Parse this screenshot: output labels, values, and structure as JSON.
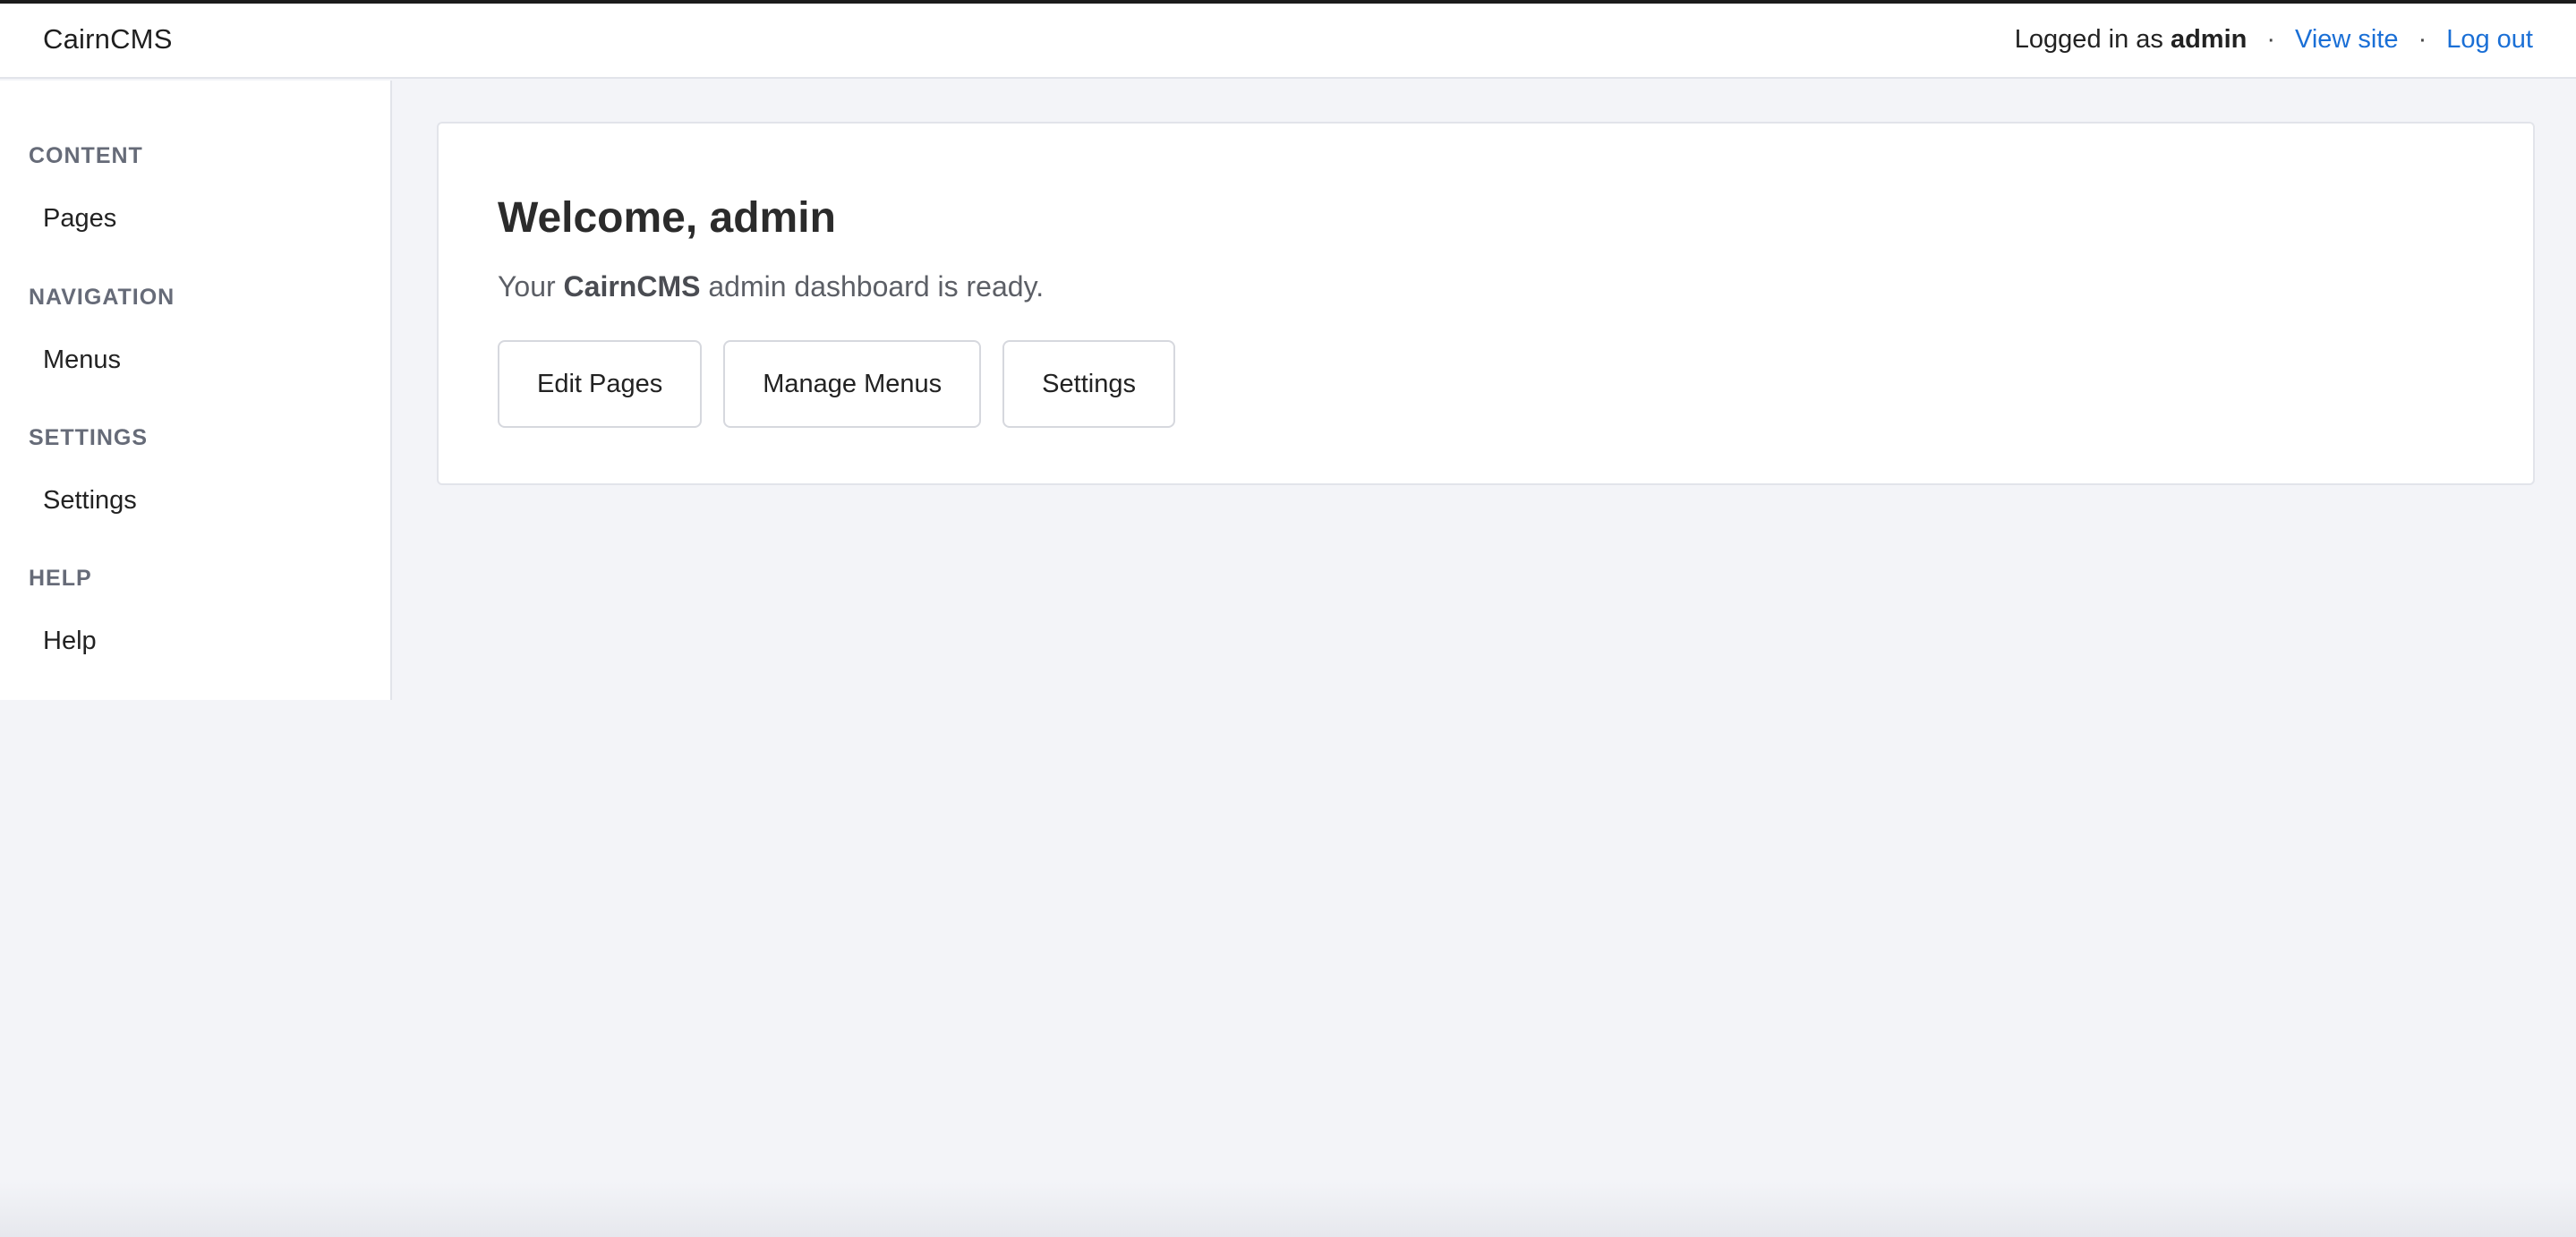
{
  "header": {
    "brand": "CairnCMS",
    "logged_in_prefix": "Logged in as",
    "username": "admin",
    "separator": "·",
    "view_site": "View site",
    "log_out": "Log out"
  },
  "sidebar": {
    "sections": [
      {
        "heading": "CONTENT",
        "item": "Pages"
      },
      {
        "heading": "NAVIGATION",
        "item": "Menus"
      },
      {
        "heading": "SETTINGS",
        "item": "Settings"
      },
      {
        "heading": "HELP",
        "item": "Help"
      }
    ]
  },
  "main": {
    "title": "Welcome, admin",
    "intro_prefix": "Your",
    "intro_brand": "CairnCMS",
    "intro_suffix": "admin dashboard is ready.",
    "buttons": {
      "edit_pages": "Edit Pages",
      "manage_menus": "Manage Menus",
      "settings": "Settings"
    }
  },
  "colors": {
    "link": "#1a6fd6",
    "background": "#f3f4f8",
    "panel": "#ffffff"
  }
}
